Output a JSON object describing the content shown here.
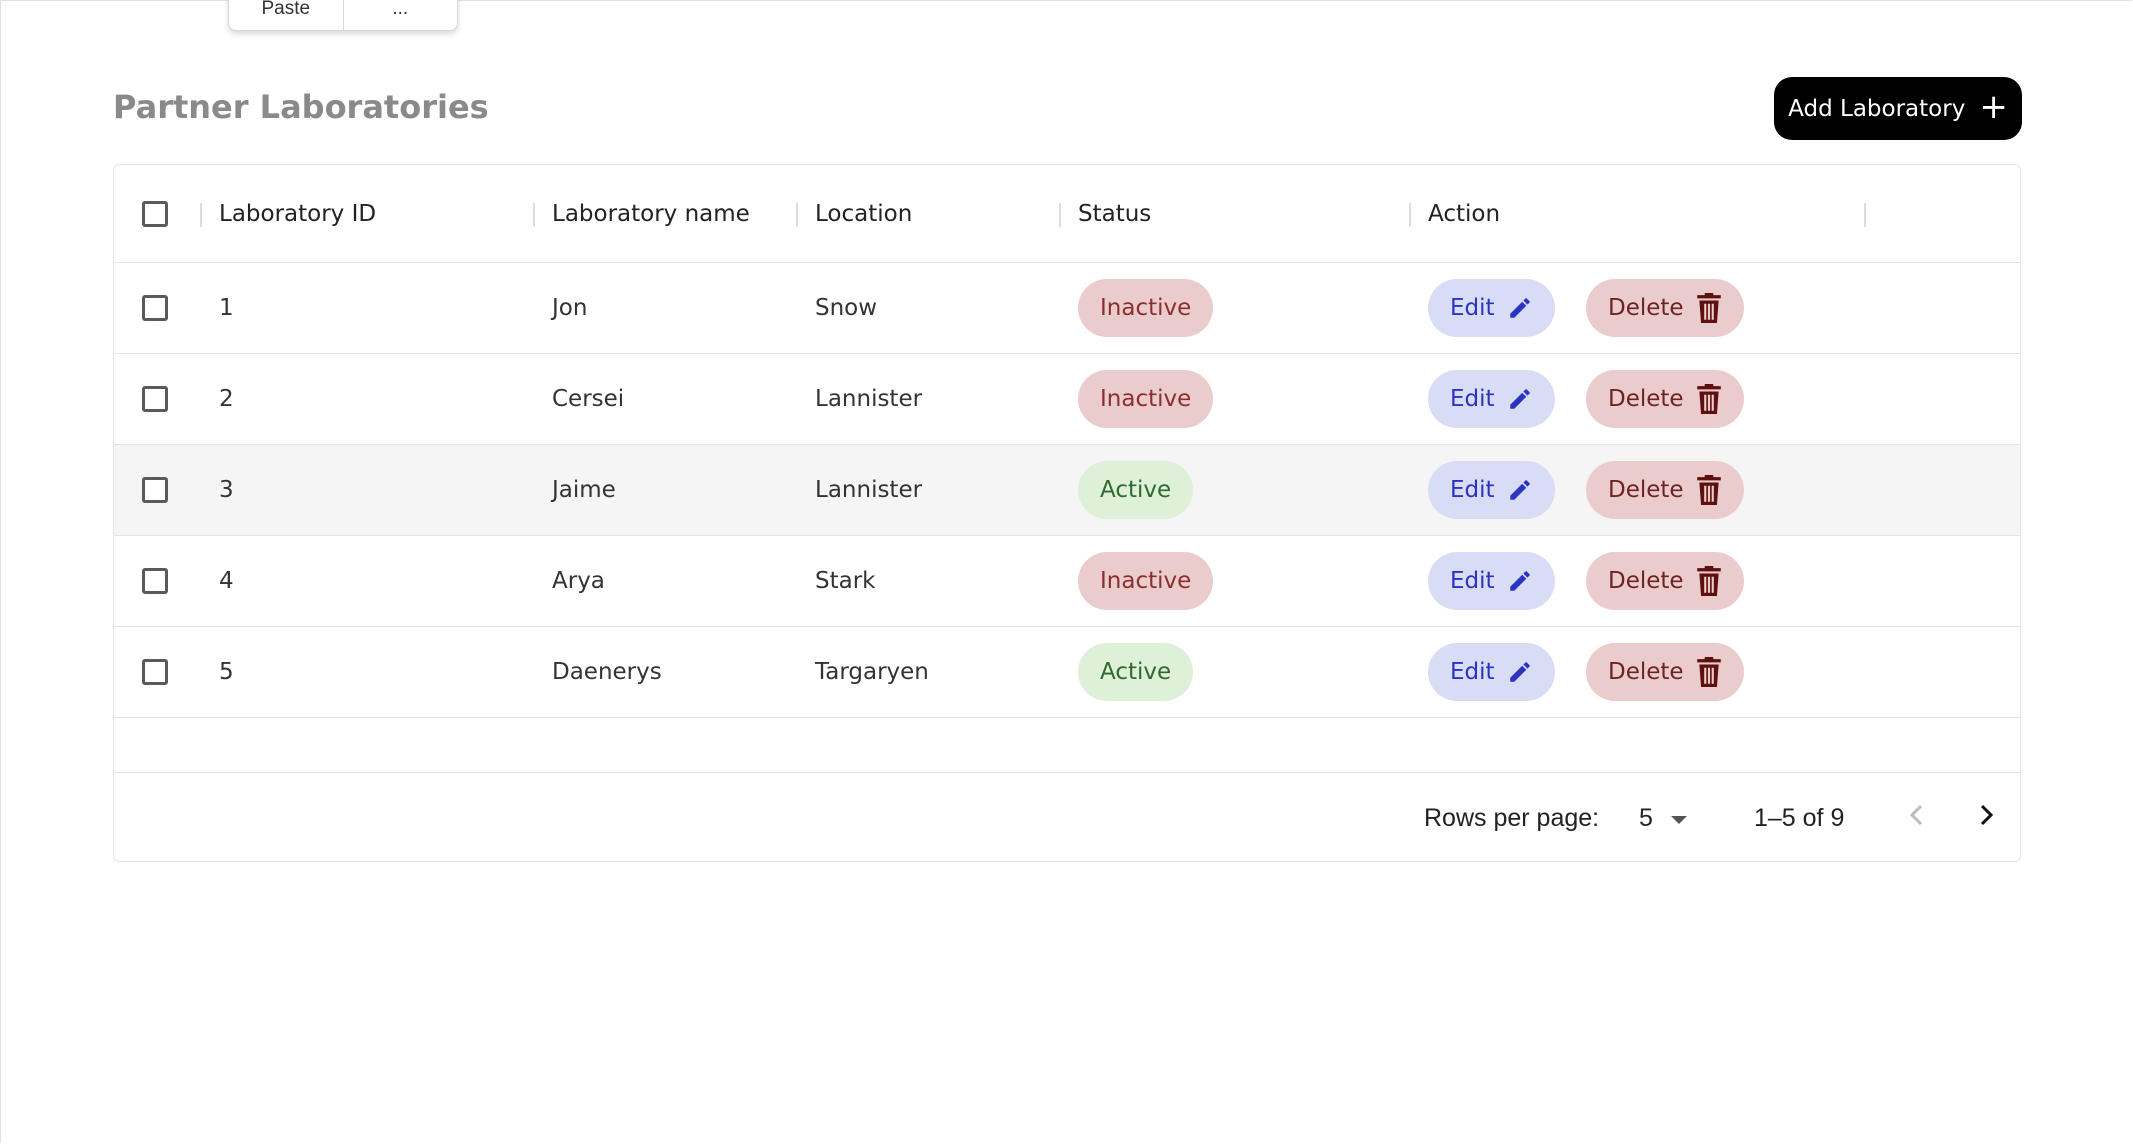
{
  "toolbar": {
    "paste_label": "Paste",
    "more_label": "..."
  },
  "page": {
    "title": "Partner Laboratories",
    "add_button_label": "Add Laboratory"
  },
  "table": {
    "columns": [
      "Laboratory ID",
      "Laboratory name",
      "Location",
      "Status",
      "Action"
    ],
    "rows": [
      {
        "id": "1",
        "name": "Jon",
        "location": "Snow",
        "status": "Inactive",
        "edit": "Edit",
        "delete": "Delete"
      },
      {
        "id": "2",
        "name": "Cersei",
        "location": "Lannister",
        "status": "Inactive",
        "edit": "Edit",
        "delete": "Delete"
      },
      {
        "id": "3",
        "name": "Jaime",
        "location": "Lannister",
        "status": "Active",
        "edit": "Edit",
        "delete": "Delete"
      },
      {
        "id": "4",
        "name": "Arya",
        "location": "Stark",
        "status": "Inactive",
        "edit": "Edit",
        "delete": "Delete"
      },
      {
        "id": "5",
        "name": "Daenerys",
        "location": "Targaryen",
        "status": "Active",
        "edit": "Edit",
        "delete": "Delete"
      }
    ]
  },
  "pagination": {
    "rows_per_page_label": "Rows per page:",
    "rows_per_page_value": "5",
    "range_label": "1–5 of 9"
  },
  "colors": {
    "inactive_bg": "#ebcccc",
    "active_bg": "#def0d8",
    "edit_bg": "#d8dcf5",
    "delete_bg": "#ebcccc",
    "primary_button": "#000000"
  },
  "icons": {
    "edit": "pencil-icon",
    "delete": "trash-icon",
    "add": "plus-icon",
    "prev": "chevron-left-icon",
    "next": "chevron-right-icon",
    "dropdown": "caret-down-icon"
  }
}
